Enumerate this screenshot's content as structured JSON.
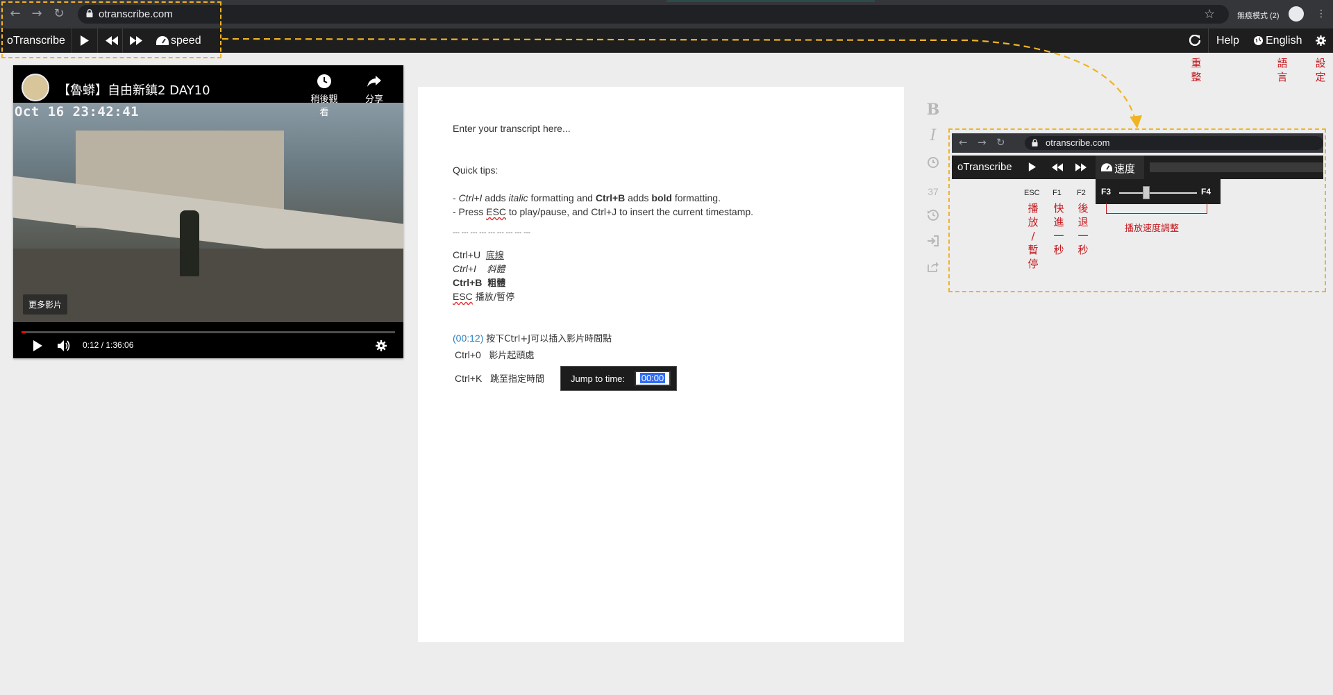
{
  "browser": {
    "url": "otranscribe.com",
    "incognito_label": "無痕模式 (2)"
  },
  "toolbar": {
    "brand": "oTranscribe",
    "speed_label": "speed",
    "help_label": "Help",
    "language_label": "English"
  },
  "annotations": {
    "reload": [
      "重",
      "整"
    ],
    "language": [
      "語",
      "言"
    ],
    "settings": [
      "設",
      "定"
    ]
  },
  "video": {
    "title": "【魯蟒】自由新鎮2 DAY10",
    "overlay_timestamp": "Oct 16 23:42:41",
    "watch_later_label": "稍後觀看",
    "share_label": "分享",
    "more_videos_label": "更多影片",
    "time_display": "0:12 / 1:36:06",
    "progress": 0.0022
  },
  "editor": {
    "placeholder_line": "Enter your transcript here...",
    "tips_heading": "Quick tips:",
    "tip1": {
      "p1": "- ",
      "ctrl_i": "Ctrl+I",
      "p2": " adds ",
      "italic": "italic",
      "p3": " formatting and ",
      "ctrl_b": "Ctrl+B",
      "p4": " adds ",
      "bold": "bold",
      "p5": " formatting."
    },
    "tip2": {
      "p1": "- Press ",
      "esc": "ESC",
      "p2": " to play/pause, and Ctrl+J to insert the current timestamp."
    },
    "divider": "--- --- --- --- --- --- --- --- ---",
    "shortcuts": [
      {
        "key": "Ctrl+U",
        "desc": "底線"
      },
      {
        "key": "Ctrl+I",
        "desc": "斜體"
      },
      {
        "key": "Ctrl+B",
        "desc": "粗體"
      },
      {
        "key": "ESC",
        "desc": "播放/暫停"
      }
    ],
    "timestamp_link": "(00:12)",
    "timestamp_desc": "按下Ctrl+J可以插入影片時間點",
    "ctrl0_key": "Ctrl+0",
    "ctrl0_desc": "影片起頭處",
    "ctrlk_key": "Ctrl+K",
    "ctrlk_desc": "跳至指定時間",
    "jump_label": "Jump to time:",
    "jump_value": "00:00"
  },
  "sidebar": {
    "bold": "B",
    "italic": "I",
    "word_count": "37"
  },
  "inset": {
    "url": "otranscribe.com",
    "brand": "oTranscribe",
    "speed_label": "速度",
    "speed_slow": "F3",
    "speed_fast": "F4",
    "speed_caption": "播放速度調整",
    "keys": [
      {
        "key": "ESC",
        "chars": [
          "播",
          "放",
          "/",
          "暫",
          "停"
        ]
      },
      {
        "key": "F1",
        "chars": [
          "快",
          "進",
          "一",
          "秒"
        ]
      },
      {
        "key": "F2",
        "chars": [
          "後",
          "退",
          "一",
          "秒"
        ]
      }
    ]
  },
  "colors": {
    "dash": "#f0b423",
    "annotation_red": "#c4161c",
    "toolbar_bg": "#1e1e1e",
    "link_blue": "#2a7fc1"
  }
}
